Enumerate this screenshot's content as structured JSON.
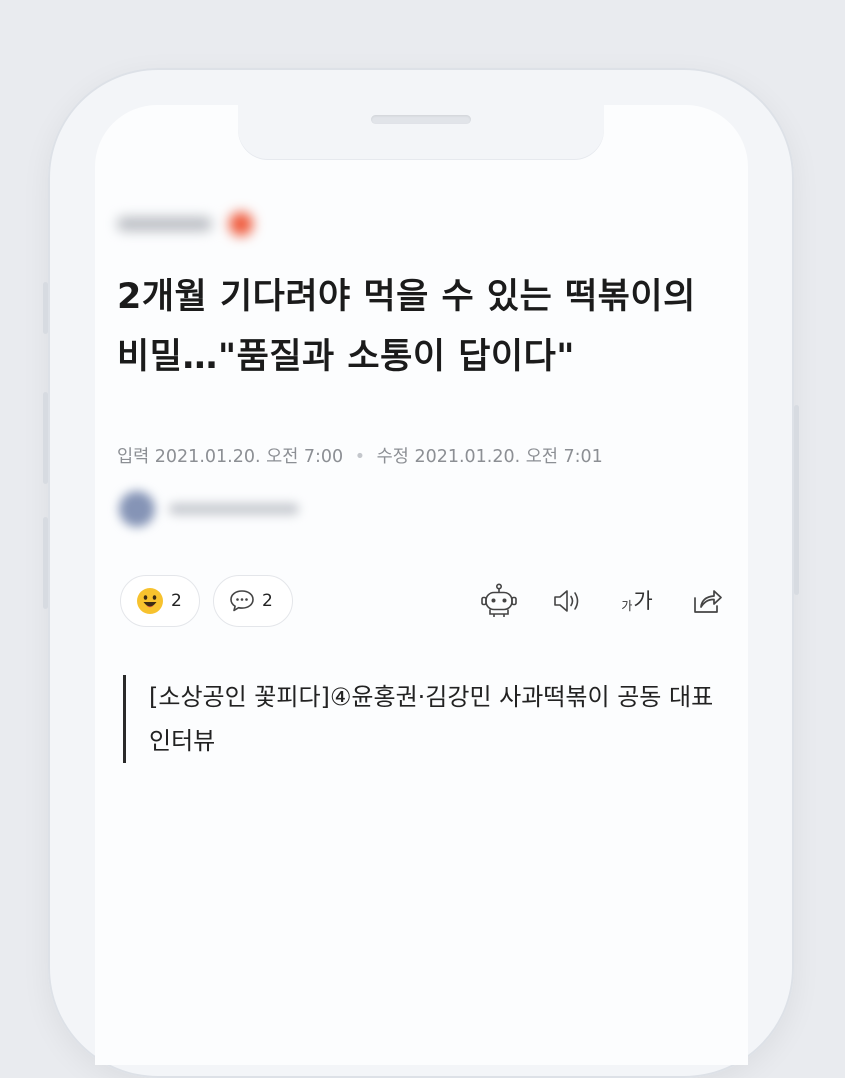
{
  "article": {
    "headline": "2개월 기다려야 먹을 수 있는 떡볶이의 비밀…\"품질과 소통이 답이다\"",
    "input_label": "입력",
    "input_datetime": "2021.01.20. 오전 7:00",
    "modified_label": "수정",
    "modified_datetime": "2021.01.20. 오전 7:01",
    "subtitle": "[소상공인 꽃피다]④윤홍권·김강민 사과떡볶이 공동 대표 인터뷰"
  },
  "actions": {
    "reaction_count": "2",
    "comment_count": "2",
    "font_size_small": "가",
    "font_size_large": "가"
  },
  "icons": [
    "smile-emoji-icon",
    "comment-icon",
    "robot-summary-icon",
    "speaker-icon",
    "font-size-icon",
    "share-icon"
  ],
  "colors": {
    "emoji": "#f7c22e",
    "headline": "#1b1b1b",
    "meta": "#8c8f94"
  }
}
